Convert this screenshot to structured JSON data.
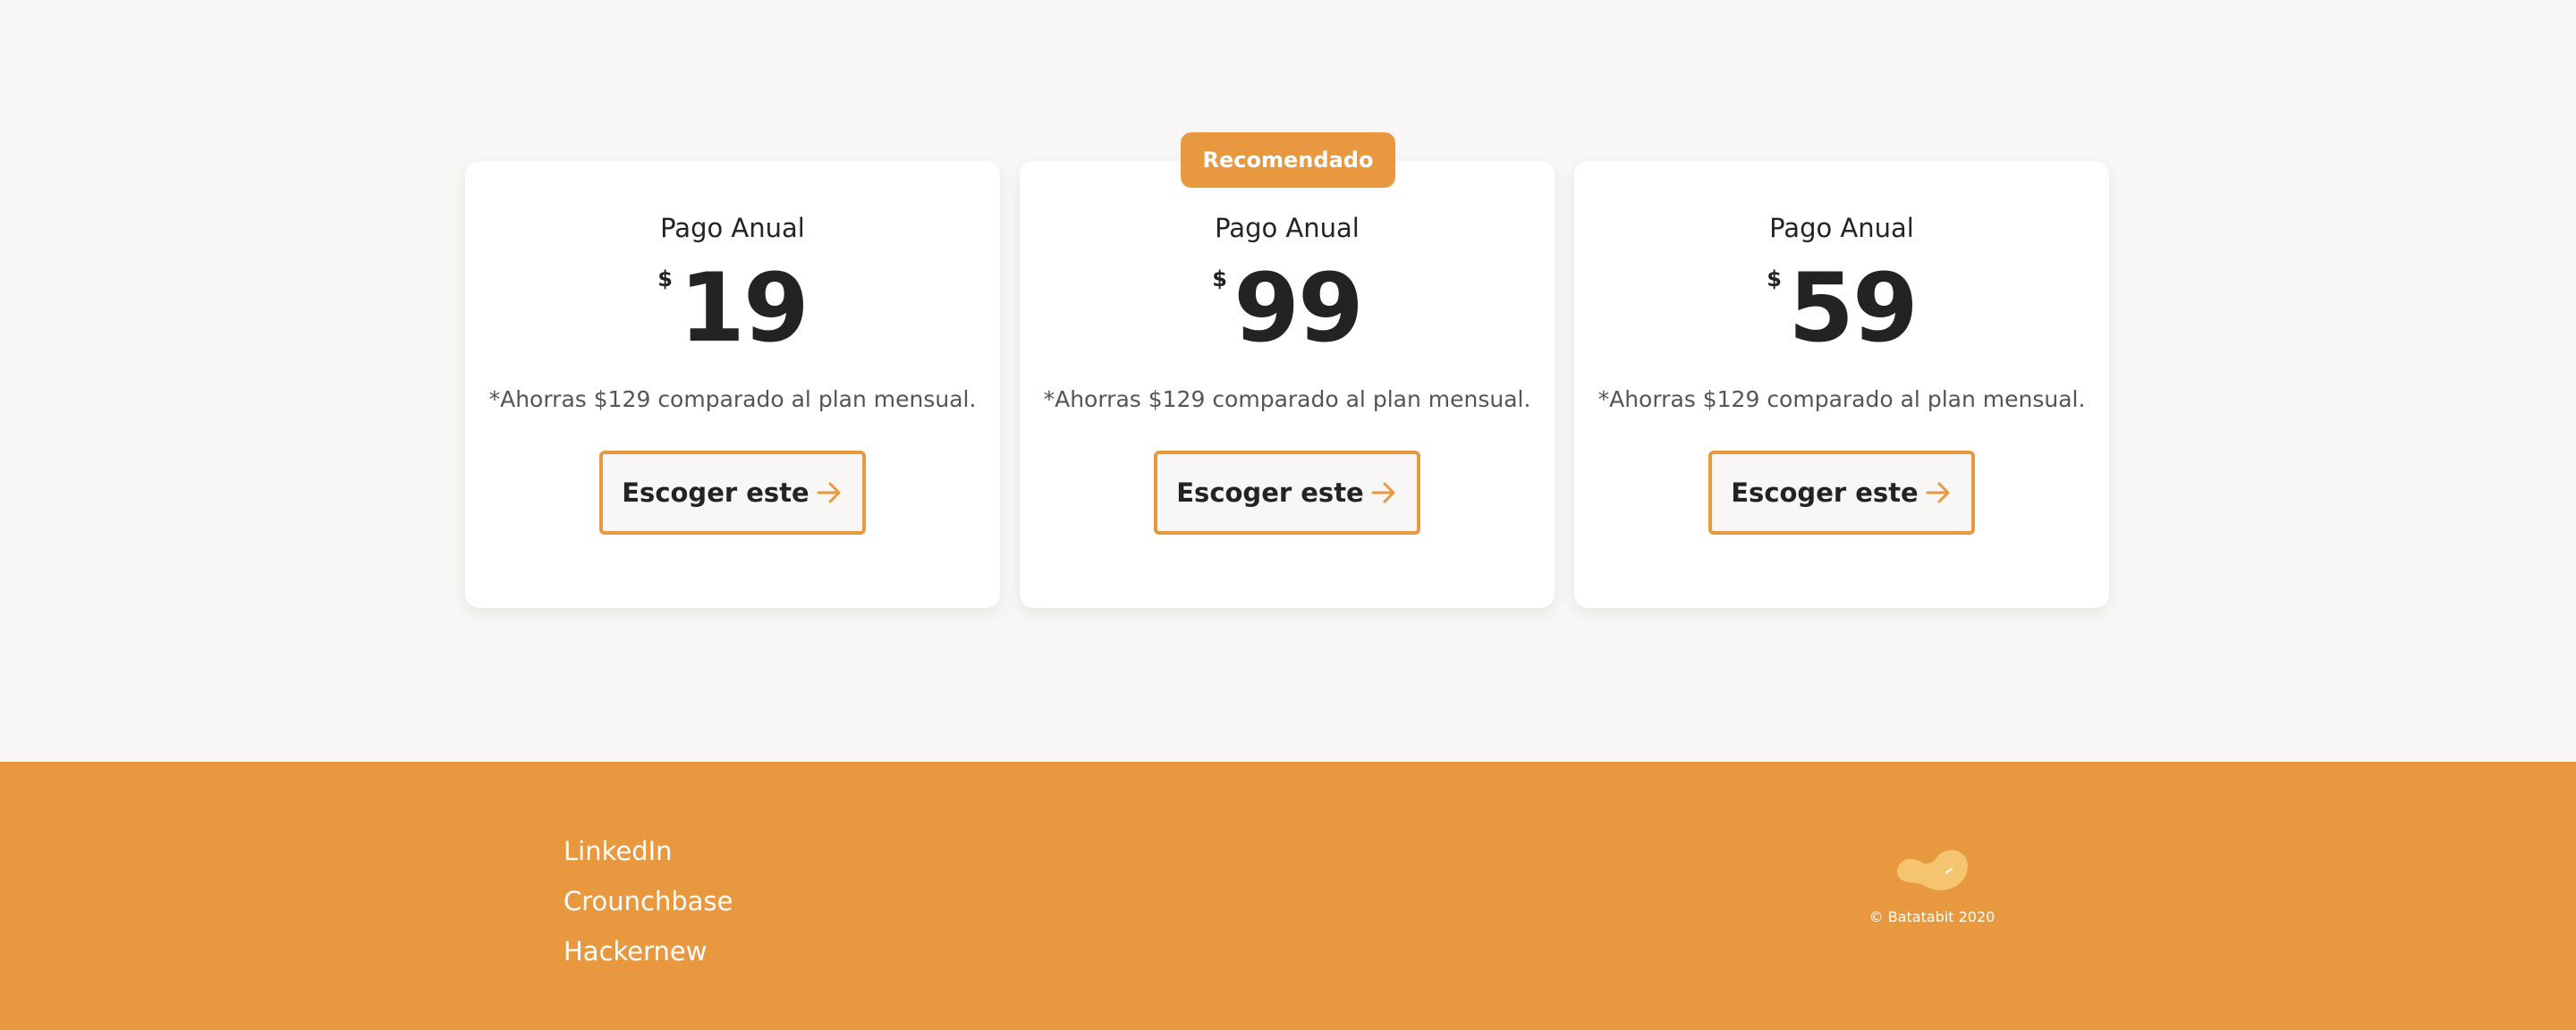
{
  "plans": [
    {
      "title": "Pago Anual",
      "currency": "$",
      "amount": "19",
      "savings": "*Ahorras $129 comparado al plan mensual.",
      "button_label": "Escoger este"
    },
    {
      "badge": "Recomendado",
      "title": "Pago Anual",
      "currency": "$",
      "amount": "99",
      "savings": "*Ahorras $129 comparado al plan mensual.",
      "button_label": "Escoger este"
    },
    {
      "title": "Pago Anual",
      "currency": "$",
      "amount": "59",
      "savings": "*Ahorras $129 comparado al plan mensual.",
      "button_label": "Escoger este"
    }
  ],
  "footer": {
    "links": [
      "LinkedIn",
      "Crounchbase",
      "Hackernew"
    ],
    "copyright": "© Batatabit 2020"
  },
  "icons": {
    "button_arrow": "arrow-right-icon",
    "brand_logo": "batatabit-logo-icon"
  },
  "colors": {
    "accent": "#e8983e",
    "background": "#f8f7f5",
    "card": "#ffffff",
    "text": "#232323"
  }
}
